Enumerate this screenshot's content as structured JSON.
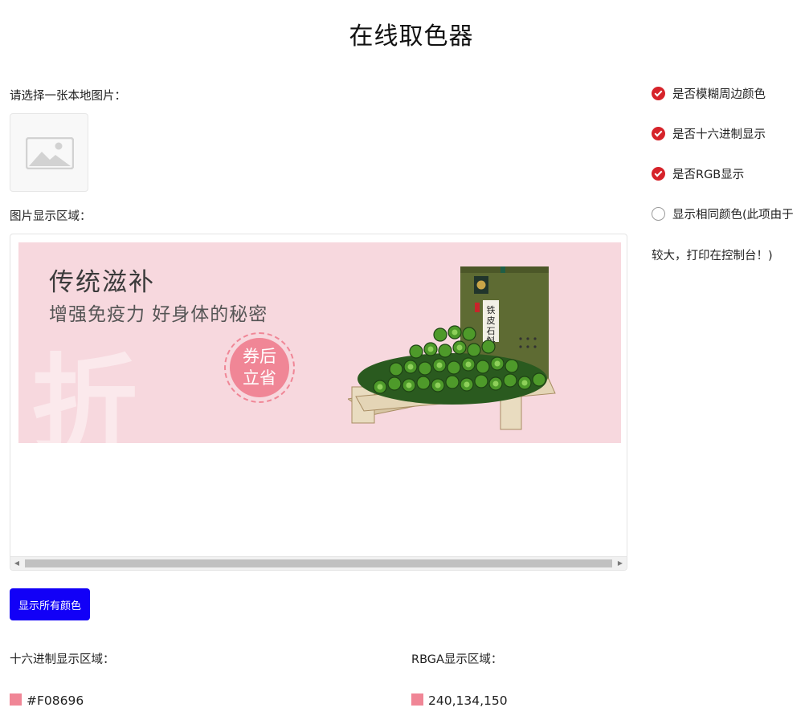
{
  "page": {
    "title": "在线取色器"
  },
  "upload": {
    "label": "请选择一张本地图片："
  },
  "display_area": {
    "label": "图片显示区域："
  },
  "banner": {
    "title": "传统滋补",
    "subtitle": "增强免疫力 好身体的秘密",
    "badge_line1": "券后",
    "badge_line2": "立省",
    "watermark": "折",
    "box_text": "铁皮石斛"
  },
  "actions": {
    "show_all_colors": "显示所有颜色"
  },
  "hex": {
    "label": "十六进制显示区域：",
    "value": "#F08696"
  },
  "rgba": {
    "label": "RBGA显示区域：",
    "value": "240,134,150"
  },
  "options": [
    {
      "label": "是否模糊周边颜色",
      "checked": true
    },
    {
      "label": "是否十六进制显示",
      "checked": true
    },
    {
      "label": "是否RGB显示",
      "checked": true
    },
    {
      "label": "显示相同颜色(此项由于",
      "label_cont": "较大，打印在控制台！)",
      "checked": false
    }
  ],
  "colors": {
    "picked": "#F08696",
    "accent_red": "#D6232A",
    "button_blue": "#1200F7",
    "banner_bg": "#F7D8DE"
  }
}
